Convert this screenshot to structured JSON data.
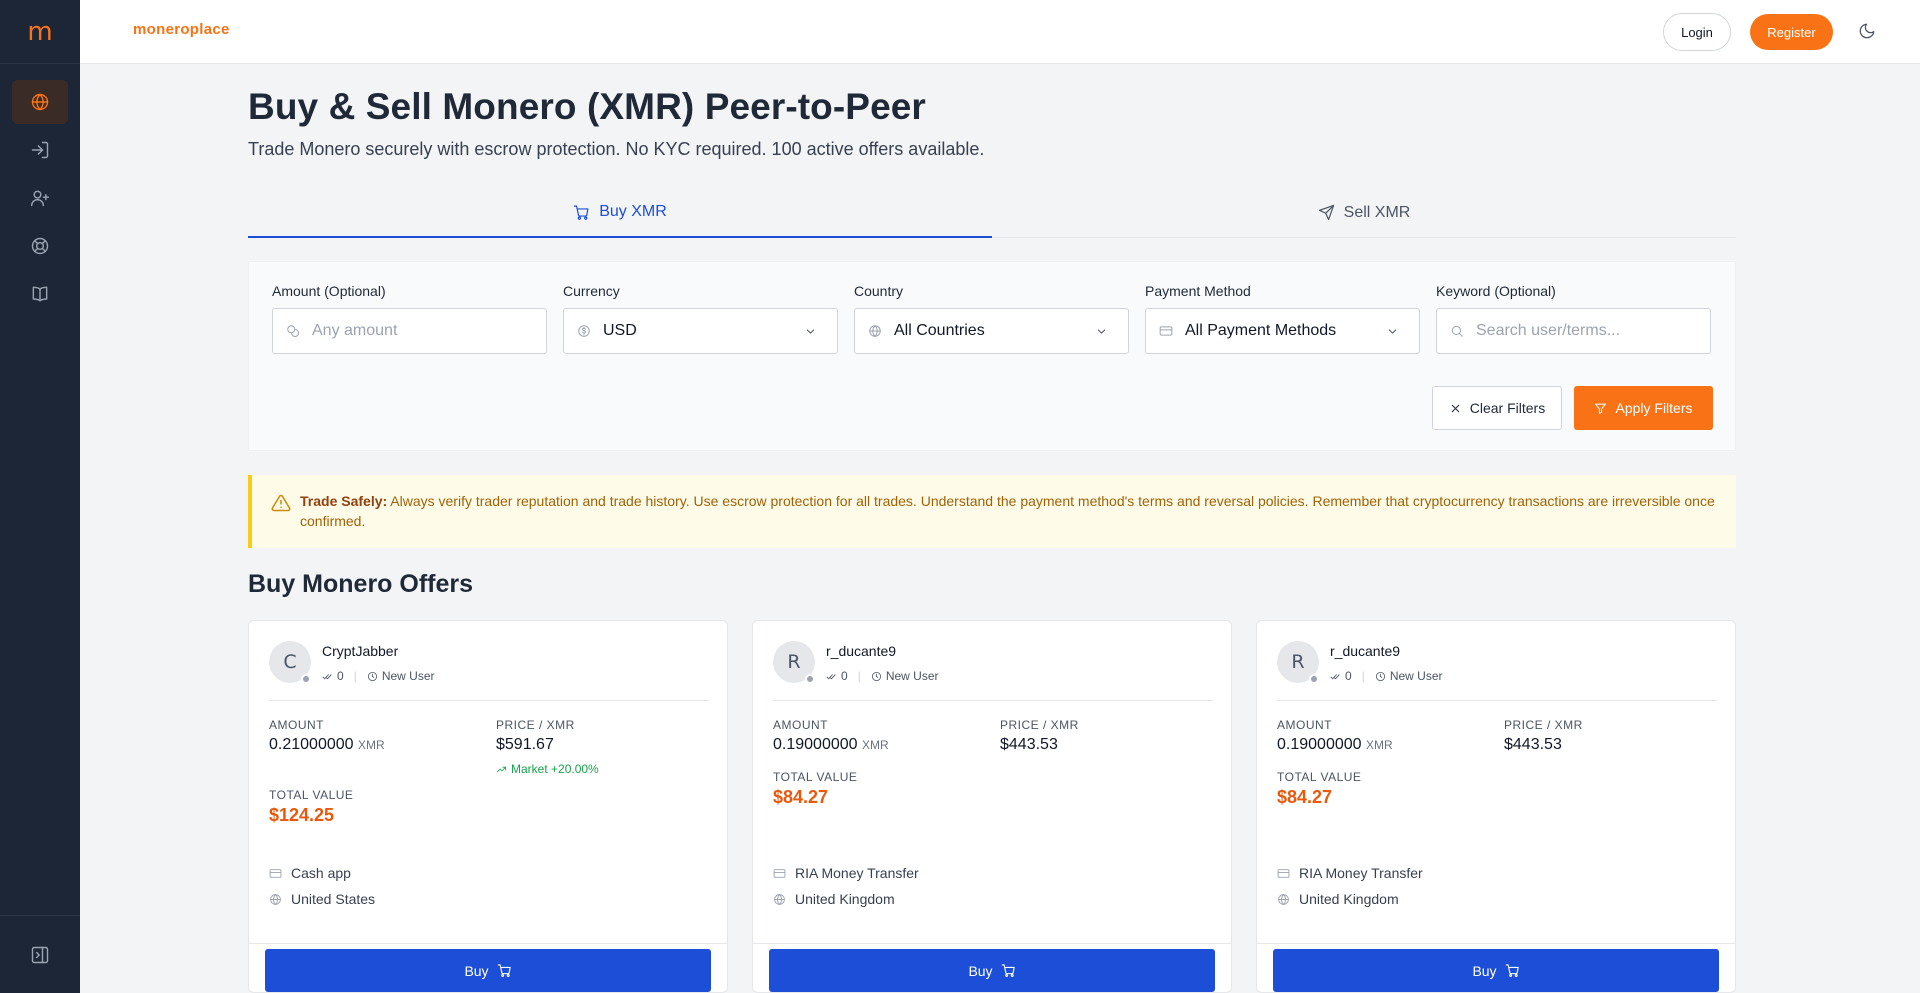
{
  "sidebar": {
    "logo": "m",
    "items": [
      {
        "icon": "globe-icon",
        "active": true
      },
      {
        "icon": "login-icon",
        "active": false
      },
      {
        "icon": "user-plus-icon",
        "active": false
      },
      {
        "icon": "lifebuoy-icon",
        "active": false
      },
      {
        "icon": "book-icon",
        "active": false
      }
    ],
    "bottom_icon": "collapse-sidebar-icon"
  },
  "header": {
    "brand": "moneroplace",
    "login_label": "Login",
    "register_label": "Register",
    "theme_icon": "moon-icon"
  },
  "page": {
    "title": "Buy & Sell Monero (XMR) Peer-to-Peer",
    "subtitle": "Trade Monero securely with escrow protection. No KYC required. 100 active offers available."
  },
  "tabs": [
    {
      "label": "Buy XMR",
      "icon": "cart-icon",
      "active": true
    },
    {
      "label": "Sell XMR",
      "icon": "send-icon",
      "active": false
    }
  ],
  "filters": {
    "amount": {
      "label": "Amount (Optional)",
      "placeholder": "Any amount",
      "icon": "coins-icon"
    },
    "currency": {
      "label": "Currency",
      "value": "USD",
      "icon": "dollar-icon"
    },
    "country": {
      "label": "Country",
      "value": "All Countries",
      "icon": "globe-icon"
    },
    "payment": {
      "label": "Payment Method",
      "value": "All Payment Methods",
      "icon": "credit-card-icon"
    },
    "keyword": {
      "label": "Keyword (Optional)",
      "placeholder": "Search user/terms...",
      "icon": "search-icon"
    },
    "clear_label": "Clear Filters",
    "apply_label": "Apply Filters"
  },
  "alert": {
    "title": "Trade Safely:",
    "text": "Always verify trader reputation and trade history. Use escrow protection for all trades. Understand the payment method's terms and reversal policies. Remember that cryptocurrency transactions are irreversible once confirmed."
  },
  "offers": {
    "section_title": "Buy Monero Offers",
    "labels": {
      "amount": "AMOUNT",
      "price": "PRICE / XMR",
      "total": "TOTAL VALUE",
      "unit": "XMR",
      "new_user": "New User",
      "buy": "Buy"
    },
    "cards": [
      {
        "initial": "C",
        "username": "CryptJabber",
        "trades": "0",
        "amount": "0.21000000",
        "price": "$591.67",
        "market": "Market +20.00%",
        "total": "$124.25",
        "payment": "Cash app",
        "country": "United States"
      },
      {
        "initial": "R",
        "username": "r_ducante9",
        "trades": "0",
        "amount": "0.19000000",
        "price": "$443.53",
        "market": null,
        "total": "$84.27",
        "payment": "RIA Money Transfer",
        "country": "United Kingdom"
      },
      {
        "initial": "R",
        "username": "r_ducante9",
        "trades": "0",
        "amount": "0.19000000",
        "price": "$443.53",
        "market": null,
        "total": "$84.27",
        "payment": "RIA Money Transfer",
        "country": "United Kingdom"
      }
    ]
  },
  "colors": {
    "accent": "#f97316",
    "primary": "#1d4ed8",
    "sidebar": "#1d2636",
    "total": "#ea580c",
    "positive": "#16a34a",
    "warning_bg": "#fefce8"
  }
}
